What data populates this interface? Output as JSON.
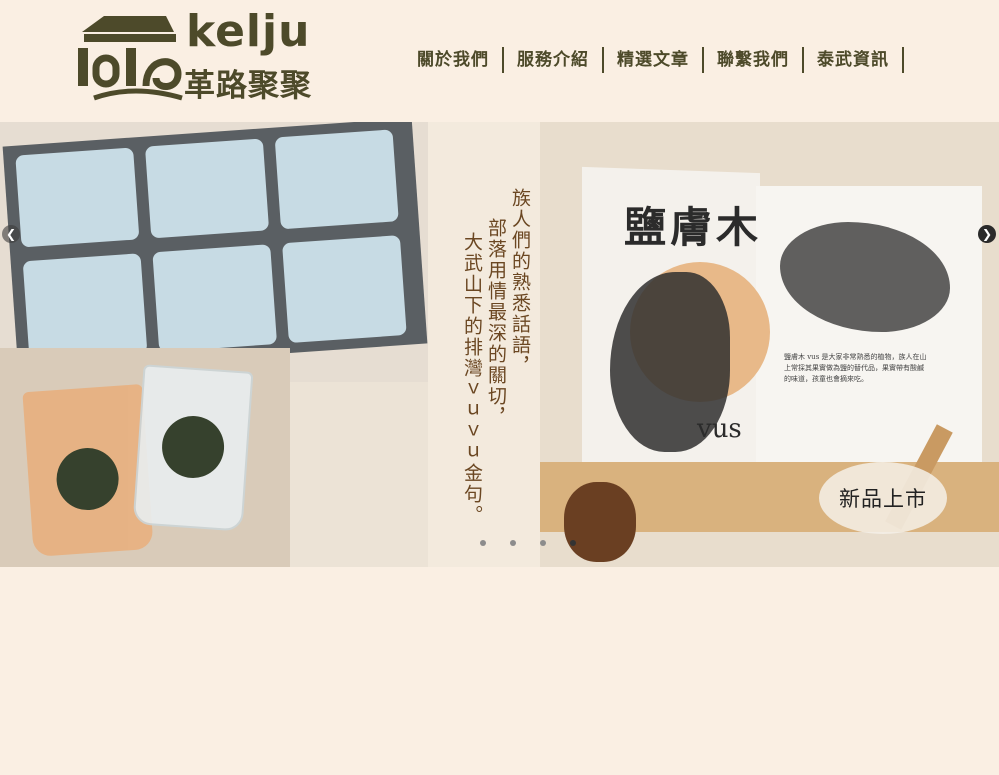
{
  "brand": {
    "name_en": "kelju",
    "name_zh": "革路聚聚",
    "logo_color": "#4d4a2a"
  },
  "nav": {
    "items": [
      {
        "label": "關於我們"
      },
      {
        "label": "服務介紹"
      },
      {
        "label": "精選文章"
      },
      {
        "label": "聯繫我們"
      },
      {
        "label": "泰武資訊"
      }
    ]
  },
  "banner": {
    "slogan_lines": [
      "族人們的熟悉話語，",
      "部落用情最深的關切，",
      "大武山下的排灣ｖｕｖｕ金句。"
    ],
    "book_title": "鹽膚木",
    "book_subtitle": "vus",
    "book_paragraph": "鹽膚木 vus 是大家非常熟悉的植物，族人在山上常採其果實做為鹽的替代品，果實帶有酸鹹的味道，孩童也會摘來吃。",
    "badge": "新品上市",
    "arrows": {
      "left": "chevron-left-icon",
      "right": "chevron-right-icon"
    },
    "slide_count": 4,
    "active_slide": 4
  },
  "colors": {
    "background": "#faefe3",
    "text_dark": "#4d4a2a",
    "slogan": "#6b4722"
  }
}
